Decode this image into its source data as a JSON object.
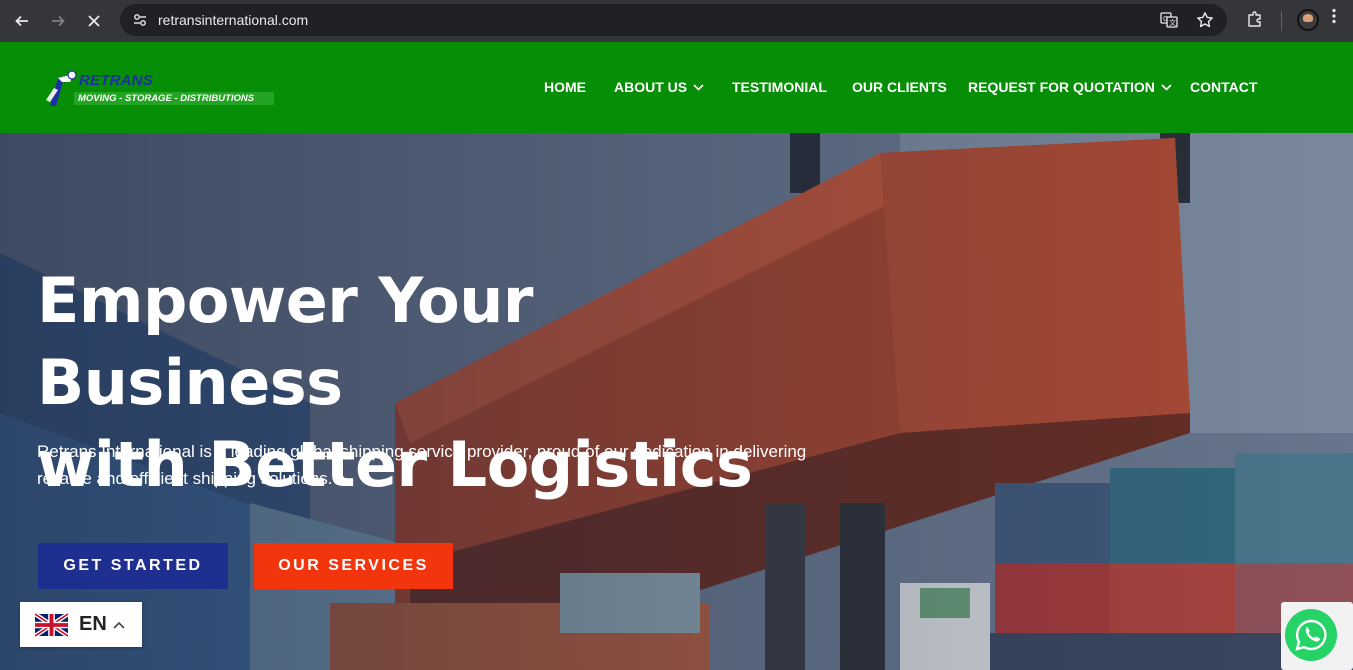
{
  "browser": {
    "url": "retransinternational.com",
    "icons": [
      "back-arrow-icon",
      "forward-arrow-icon",
      "stop-loading-icon",
      "site-info-icon",
      "translate-icon",
      "bookmark-star-icon",
      "extensions-icon",
      "profile-avatar",
      "kebab-menu-icon"
    ]
  },
  "header": {
    "logo": {
      "title": "RETRANS INTERNATIONAL",
      "tagline": "MOVING - STORAGE - DISTRIBUTIONS"
    },
    "nav": [
      {
        "label": "HOME",
        "has_dropdown": false
      },
      {
        "label": "ABOUT US",
        "has_dropdown": true
      },
      {
        "label": "TESTIMONIAL",
        "has_dropdown": false
      },
      {
        "label": "OUR CLIENTS",
        "has_dropdown": false
      },
      {
        "label": "REQUEST FOR QUOTATION",
        "has_dropdown": true
      },
      {
        "label": "CONTACT",
        "has_dropdown": false
      }
    ],
    "background_color": "#078e07"
  },
  "hero": {
    "title_line1": "Empower Your Business",
    "title_line2": "with Better Logistics",
    "description_line1": "Retrans International is a leading global shipping service provider, proud of our dedication in delivering",
    "description_line2": "reliable and efficient shipping solutions.",
    "buttons": {
      "primary": "GET STARTED",
      "secondary": "OUR SERVICES"
    },
    "colors": {
      "primary_button": "#1f2f8f",
      "secondary_button": "#f2350c"
    }
  },
  "language_widget": {
    "code": "EN",
    "flag": "uk-flag-icon"
  },
  "whatsapp": {
    "icon": "whatsapp-icon"
  }
}
